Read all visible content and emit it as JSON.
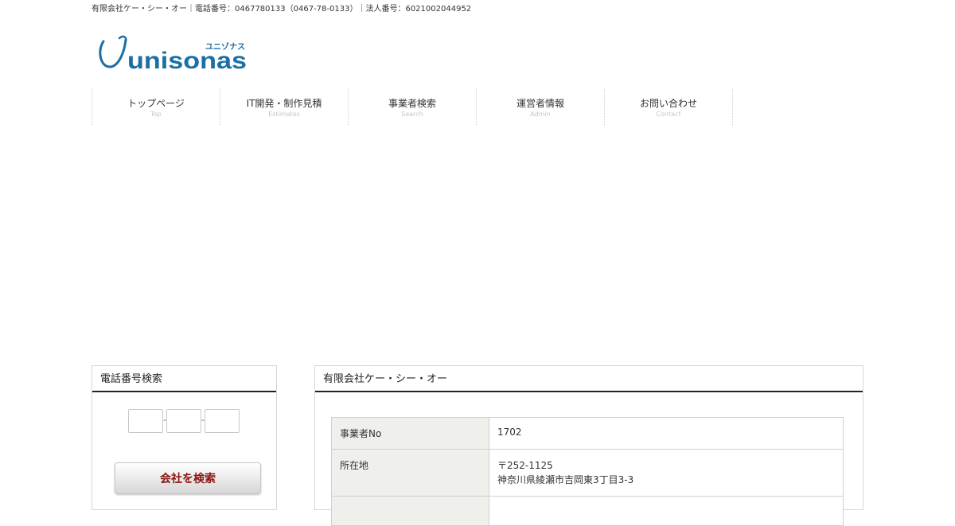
{
  "topbar": {
    "text": "有限会社ケー・シー・オー｜電話番号：0467780133（0467-78-0133）｜法人番号：6021002044952"
  },
  "logo": {
    "wordmark": "unisonas",
    "kana": "ユニゾナス",
    "color": "#1a6fa3"
  },
  "nav": [
    {
      "label": "トップページ",
      "sub": "Top"
    },
    {
      "label": "IT開発・制作見積",
      "sub": "Estimates"
    },
    {
      "label": "事業者検索",
      "sub": "Search"
    },
    {
      "label": "運営者情報",
      "sub": "Admin"
    },
    {
      "label": "お問い合わせ",
      "sub": "Contact"
    }
  ],
  "sidebar": {
    "title": "電話番号検索",
    "separator": "-",
    "search_button": "会社を検索"
  },
  "main": {
    "title": "有限会社ケー・シー・オー",
    "rows": [
      {
        "label": "事業者No",
        "value": "1702"
      },
      {
        "label": "所在地",
        "postal": "〒252-1125",
        "address": "神奈川県綾瀬市吉岡東3丁目3-3"
      }
    ]
  },
  "colors": {
    "accent": "#1a6fa3",
    "button_text": "#8c1410",
    "th_bg": "#efefec"
  }
}
